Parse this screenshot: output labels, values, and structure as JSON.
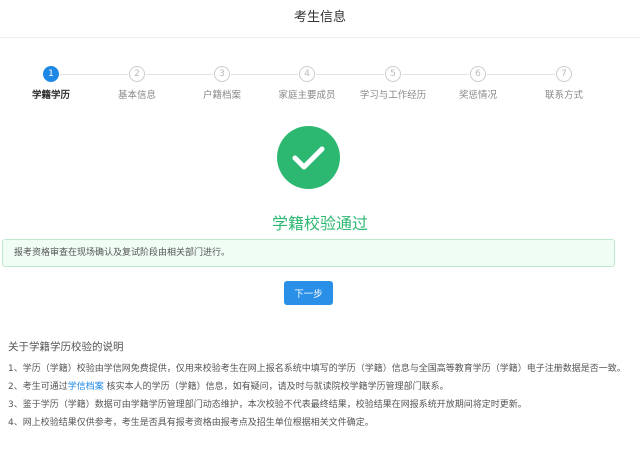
{
  "header": {
    "title": "考生信息"
  },
  "steps": [
    {
      "num": "1",
      "label": "学籍学历"
    },
    {
      "num": "2",
      "label": "基本信息"
    },
    {
      "num": "3",
      "label": "户籍档案"
    },
    {
      "num": "4",
      "label": "家庭主要成员"
    },
    {
      "num": "5",
      "label": "学习与工作经历"
    },
    {
      "num": "6",
      "label": "奖惩情况"
    },
    {
      "num": "7",
      "label": "联系方式"
    }
  ],
  "current_step": 1,
  "result": {
    "title": "学籍校验通过",
    "alert": "报考资格审查在现场确认及复试阶段由相关部门进行。",
    "next_label": "下一步"
  },
  "notes": {
    "title": "关于学籍学历校验的说明",
    "item1": "1、学历（学籍）校验由学信网免费提供，仅用来校验考生在网上报名系统中填写的学历（学籍）信息与全国高等教育学历（学籍）电子注册数据是否一致。",
    "item2_pre": "2、考生可通过",
    "item2_link": "学信档案",
    "item2_post": " 核实本人的学历（学籍）信息，如有疑问，请及时与就读院校学籍学历管理部门联系。",
    "item3": "3、鉴于学历（学籍）数据可由学籍学历管理部门动态维护，本次校验不代表最终结果，校验结果在网报系统开放期间将定时更新。",
    "item4": "4、网上校验结果仅供参考，考生是否具有报考资格由报考点及招生单位根据相关文件确定。"
  },
  "colors": {
    "accent": "#1e88e5",
    "success": "#2db872"
  }
}
